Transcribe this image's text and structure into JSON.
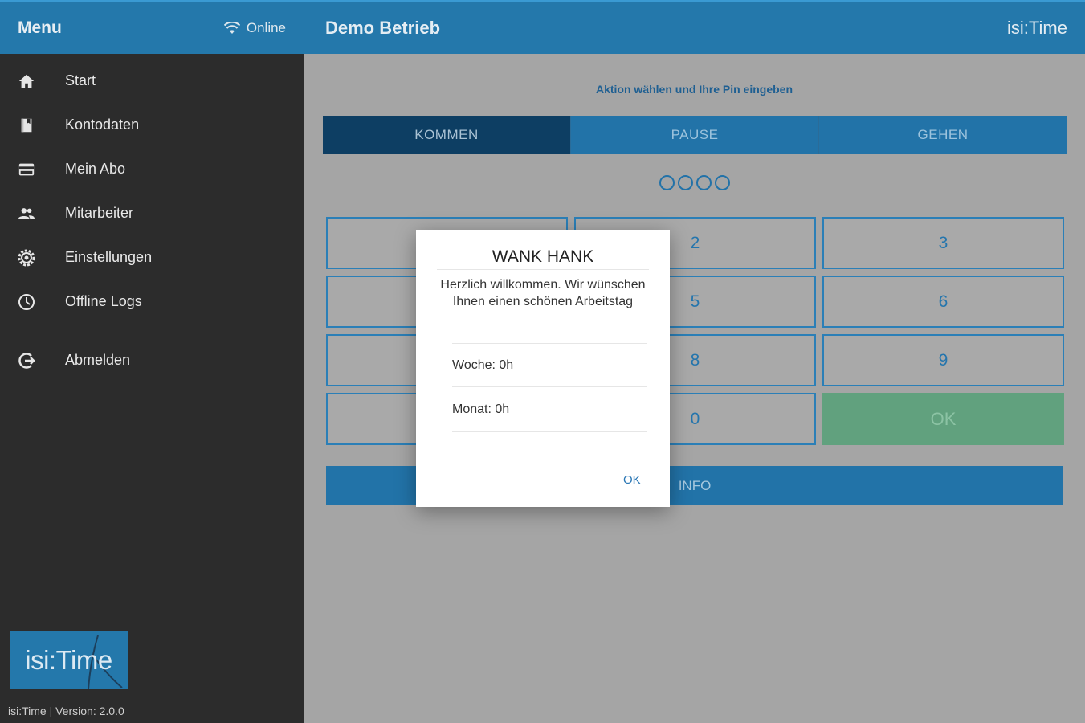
{
  "sidebar": {
    "title": "Menu",
    "status": "Online",
    "items": [
      {
        "label": "Start",
        "icon": "home-icon"
      },
      {
        "label": "Kontodaten",
        "icon": "book-icon"
      },
      {
        "label": "Mein Abo",
        "icon": "credit-card-icon"
      },
      {
        "label": "Mitarbeiter",
        "icon": "people-icon"
      },
      {
        "label": "Einstellungen",
        "icon": "settings-icon"
      },
      {
        "label": "Offline Logs",
        "icon": "clock-icon"
      },
      {
        "label": "Abmelden",
        "icon": "logout-icon"
      }
    ],
    "logo_text": "isi:Time",
    "version": "isi:Time | Version: 2.0.0"
  },
  "header": {
    "title": "Demo Betrieb",
    "brand": "isi:Time"
  },
  "main": {
    "instruction": "Aktion wählen und Ihre Pin eingeben",
    "tabs": [
      {
        "label": "KOMMEN",
        "active": true
      },
      {
        "label": "PAUSE",
        "active": false
      },
      {
        "label": "GEHEN",
        "active": false
      }
    ],
    "pin_length": 4,
    "keys": [
      "",
      "2",
      "3",
      "",
      "5",
      "6",
      "",
      "8",
      "9",
      "",
      "0",
      "OK"
    ],
    "info_label": "INFO"
  },
  "modal": {
    "title": "WANK HANK",
    "message": "Herzlich willkommen. Wir wünschen Ihnen einen schönen Arbeitstag",
    "week": "Woche: 0h",
    "month": "Monat: 0h",
    "ok_label": "OK"
  },
  "colors": {
    "brand_blue": "#2478ab",
    "active_tab": "#0d3e63",
    "ok_green": "#61a17e",
    "sidebar_bg": "#2c2c2c"
  }
}
